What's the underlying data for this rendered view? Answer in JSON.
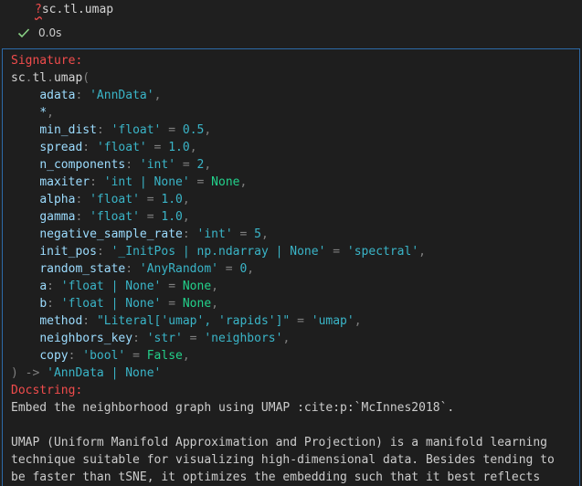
{
  "input_cell": {
    "code_prefix": "?",
    "code": "sc.tl.umap"
  },
  "execution": {
    "time": "0.0s",
    "status_icon": "check-icon",
    "status_color": "#89d185"
  },
  "output": {
    "signature_label": "Signature:",
    "call": {
      "module": "sc",
      "submodule": "tl",
      "func": "umap",
      "open": "(",
      "close": ") -> ",
      "return_type": "'AnnData | None'"
    },
    "params": [
      {
        "name": "adata",
        "sep": ": ",
        "type": "'AnnData'",
        "eq": "",
        "default": "",
        "dkind": "",
        "comma": ","
      },
      {
        "name": "*",
        "sep": "",
        "type": "",
        "eq": "",
        "default": "",
        "dkind": "",
        "comma": ","
      },
      {
        "name": "min_dist",
        "sep": ": ",
        "type": "'float'",
        "eq": " = ",
        "default": "0.5",
        "dkind": "num",
        "comma": ","
      },
      {
        "name": "spread",
        "sep": ": ",
        "type": "'float'",
        "eq": " = ",
        "default": "1.0",
        "dkind": "num",
        "comma": ","
      },
      {
        "name": "n_components",
        "sep": ": ",
        "type": "'int'",
        "eq": " = ",
        "default": "2",
        "dkind": "num",
        "comma": ","
      },
      {
        "name": "maxiter",
        "sep": ": ",
        "type": "'int | None'",
        "eq": " = ",
        "default": "None",
        "dkind": "kw",
        "comma": ","
      },
      {
        "name": "alpha",
        "sep": ": ",
        "type": "'float'",
        "eq": " = ",
        "default": "1.0",
        "dkind": "num",
        "comma": ","
      },
      {
        "name": "gamma",
        "sep": ": ",
        "type": "'float'",
        "eq": " = ",
        "default": "1.0",
        "dkind": "num",
        "comma": ","
      },
      {
        "name": "negative_sample_rate",
        "sep": ": ",
        "type": "'int'",
        "eq": " = ",
        "default": "5",
        "dkind": "num",
        "comma": ","
      },
      {
        "name": "init_pos",
        "sep": ": ",
        "type": "'_InitPos | np.ndarray | None'",
        "eq": " = ",
        "default": "'spectral'",
        "dkind": "str",
        "comma": ","
      },
      {
        "name": "random_state",
        "sep": ": ",
        "type": "'AnyRandom'",
        "eq": " = ",
        "default": "0",
        "dkind": "num",
        "comma": ","
      },
      {
        "name": "a",
        "sep": ": ",
        "type": "'float | None'",
        "eq": " = ",
        "default": "None",
        "dkind": "kw",
        "comma": ","
      },
      {
        "name": "b",
        "sep": ": ",
        "type": "'float | None'",
        "eq": " = ",
        "default": "None",
        "dkind": "kw",
        "comma": ","
      },
      {
        "name": "method",
        "sep": ": ",
        "type": "\"Literal['umap', 'rapids']\"",
        "eq": " = ",
        "default": "'umap'",
        "dkind": "str",
        "comma": ","
      },
      {
        "name": "neighbors_key",
        "sep": ": ",
        "type": "'str'",
        "eq": " = ",
        "default": "'neighbors'",
        "dkind": "str",
        "comma": ","
      },
      {
        "name": "copy",
        "sep": ": ",
        "type": "'bool'",
        "eq": " = ",
        "default": "False",
        "dkind": "kw",
        "comma": ","
      }
    ],
    "docstring_label": "Docstring:",
    "doc_lines": [
      "Embed the neighborhood graph using UMAP :cite:p:`McInnes2018`.",
      "",
      "UMAP (Uniform Manifold Approximation and Projection) is a manifold learning",
      "technique suitable for visualizing high-dimensional data. Besides tending to",
      "be faster than tSNE, it optimizes the embedding such that it best reflects"
    ]
  },
  "colors": {
    "label_red": "#f14c4c",
    "param_blue": "#9cdcfe",
    "type_teal": "#4ec9b0",
    "value_cyan": "#3ab5c8",
    "keyword_green": "#23d18b",
    "cell_border": "#2d6aa8"
  }
}
